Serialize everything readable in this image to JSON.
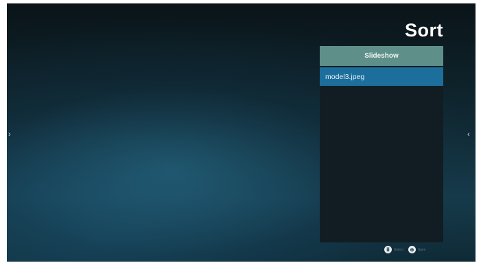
{
  "title": "Sort",
  "panel": {
    "header": "Slideshow",
    "items": [
      {
        "label": "model3.jpeg",
        "selected": true
      }
    ]
  },
  "navigation": {
    "left_arrow": "›",
    "right_arrow": "‹"
  },
  "hints": [
    {
      "key": "ⅲ",
      "label": "Select",
      "icon": "remote-button-icon"
    },
    {
      "key": "⊕",
      "label": "Save",
      "icon": "remote-button-icon"
    }
  ],
  "colors": {
    "header_bg": "#5f8f89",
    "selected_row_bg": "#1c6e9c",
    "panel_bg": "#111d22"
  }
}
